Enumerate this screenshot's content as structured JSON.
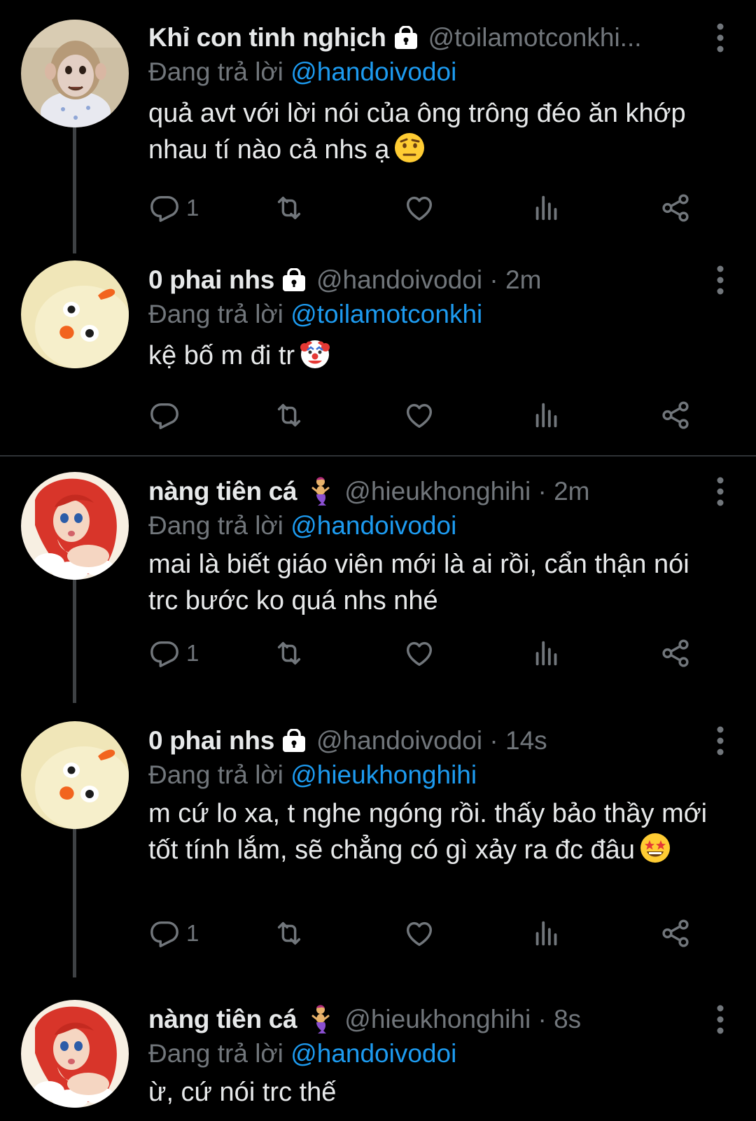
{
  "tweets": [
    {
      "name": "Khỉ con tinh nghịch",
      "handle": "@toilamotconkhi...",
      "time": "",
      "reply_prefix": "Đang trả lời",
      "reply_to": "@handoivodoi",
      "text": "quả avt với lời nói của ông trông đéo ăn khớp nhau tí nào cả nhs ạ",
      "emoji": "face-with-raised-eyebrow-emoji",
      "reply_count": "1",
      "verified_icon": "lock-icon",
      "avatar": "monkey-avatar"
    },
    {
      "name": "0 phai nhs",
      "handle": "@handoivodoi · 2m",
      "reply_prefix": "Đang trả lời",
      "reply_to": "@toilamotconkhi",
      "text": "kệ bố m đi tr",
      "emoji": "clown-face-emoji",
      "reply_count": "",
      "verified_icon": "lock-icon",
      "avatar": "duck-avatar"
    },
    {
      "name": "nàng tiên cá",
      "handle": "@hieukhonghihi · 2m",
      "reply_prefix": "Đang trả lời",
      "reply_to": "@handoivodoi",
      "text": "mai là biết giáo viên mới là ai rồi, cẩn thận nói trc bước ko quá nhs nhé",
      "emoji": "",
      "reply_count": "1",
      "verified_icon": "mermaid-emoji",
      "avatar": "mermaid-avatar"
    },
    {
      "name": "0 phai nhs",
      "handle": "@handoivodoi · 14s",
      "reply_prefix": "Đang trả lời",
      "reply_to": "@hieukhonghihi",
      "text": "m cứ lo xa, t nghe ngóng rồi. thấy bảo thầy mới tốt tính lắm, sẽ chẳng có gì xảy ra đc đâu",
      "emoji": "star-struck-emoji",
      "reply_count": "1",
      "verified_icon": "lock-icon",
      "avatar": "duck-avatar"
    },
    {
      "name": "nàng tiên cá",
      "handle": "@hieukhonghihi · 8s",
      "reply_prefix": "Đang trả lời",
      "reply_to": "@handoivodoi",
      "text": "ừ, cứ nói trc thế",
      "emoji": "",
      "reply_count": "",
      "verified_icon": "mermaid-emoji",
      "avatar": "mermaid-avatar"
    }
  ],
  "colors": {
    "background": "#000000",
    "text": "#e7e9ea",
    "muted": "#71767b",
    "mention": "#1d9bf0",
    "thread_line": "#3e4144"
  },
  "icons": {
    "reply": "reply-icon",
    "retweet": "retweet-icon",
    "like": "heart-icon",
    "views": "views-icon",
    "share": "share-icon",
    "more": "more-vertical-icon"
  }
}
